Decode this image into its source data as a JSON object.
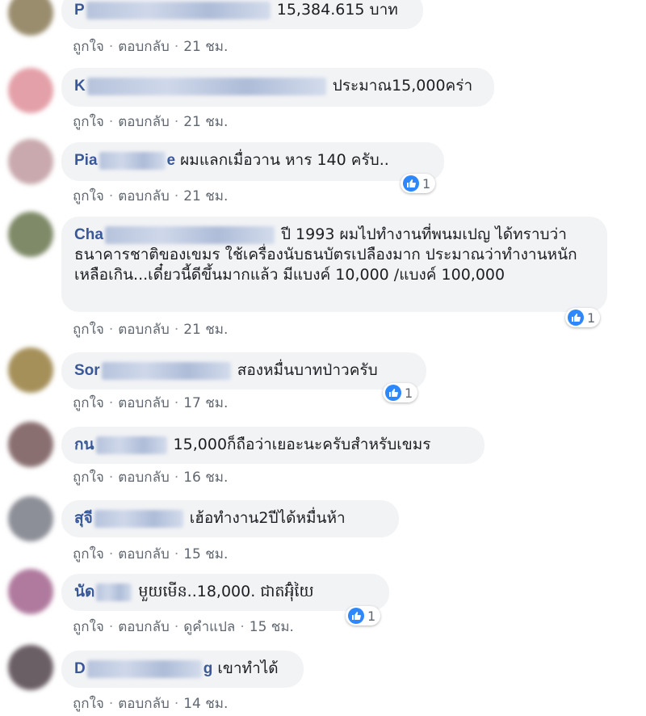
{
  "actions": {
    "like": "ถูกใจ",
    "reply": "ตอบกลับ",
    "translate": "ดูคำแปล",
    "dot": "·"
  },
  "reaction_icon": "like-icon",
  "accent_color": "#385898",
  "comments": [
    {
      "author_prefix": "P",
      "text": "15,384.615 บาท",
      "time": "21 ชม.",
      "avatar_color": "#9a8d6e"
    },
    {
      "author_prefix": "K",
      "text": "ประมาณ15,000คร่า",
      "time": "21 ชม.",
      "avatar_color": "#e4a0a8"
    },
    {
      "author_prefix": "Pia",
      "author_suffix": "e",
      "text": "ผมแลกเมื่อวาน หาร 140 ครับ..",
      "time": "21 ชม.",
      "reactions": "1",
      "avatar_color": "#c9a9ad"
    },
    {
      "author_prefix": "Cha",
      "text": "ปี 1993 ผมไปทำงานที่พนมเปญ ได้ทราบว่าธนาคารชาติของเขมร ใช้เครื่องนับธนบัตรเปลืองมาก ประมาณว่าทำงานหนักเหลือเกิน...เดี๋ยวนี้ดีขึ้นมากแล้ว มีแบงค์ 10,000 /แบงค์ 100,000",
      "time": "21 ชม.",
      "reactions": "1",
      "avatar_color": "#7f8a68"
    },
    {
      "author_prefix": "Sor",
      "text": "สองหมื่นบาทป่าวครับ",
      "time": "17 ชม.",
      "reactions": "1",
      "avatar_color": "#a6905a"
    },
    {
      "author_prefix": "กน",
      "text": "15,000ก็ถือว่าเยอะนะครับสำหรับเขมร",
      "time": "16 ชม.",
      "avatar_color": "#8a6f70"
    },
    {
      "author_prefix": "สุจี",
      "text": "เฮ้อทำงาน2ปีได้หมื่นห้า",
      "time": "15 ชม.",
      "avatar_color": "#8d8f98"
    },
    {
      "author_prefix": "นัด",
      "text": "មួយមើន..18,000. ជាតអ៊ុំយៃ",
      "time": "15 ชม.",
      "reactions": "1",
      "avatar_color": "#b07a9e"
    },
    {
      "author_prefix": "D",
      "author_suffix": "g",
      "text": "เขาทำได้",
      "time": "14 ชม.",
      "avatar_color": "#6b5f66"
    }
  ]
}
